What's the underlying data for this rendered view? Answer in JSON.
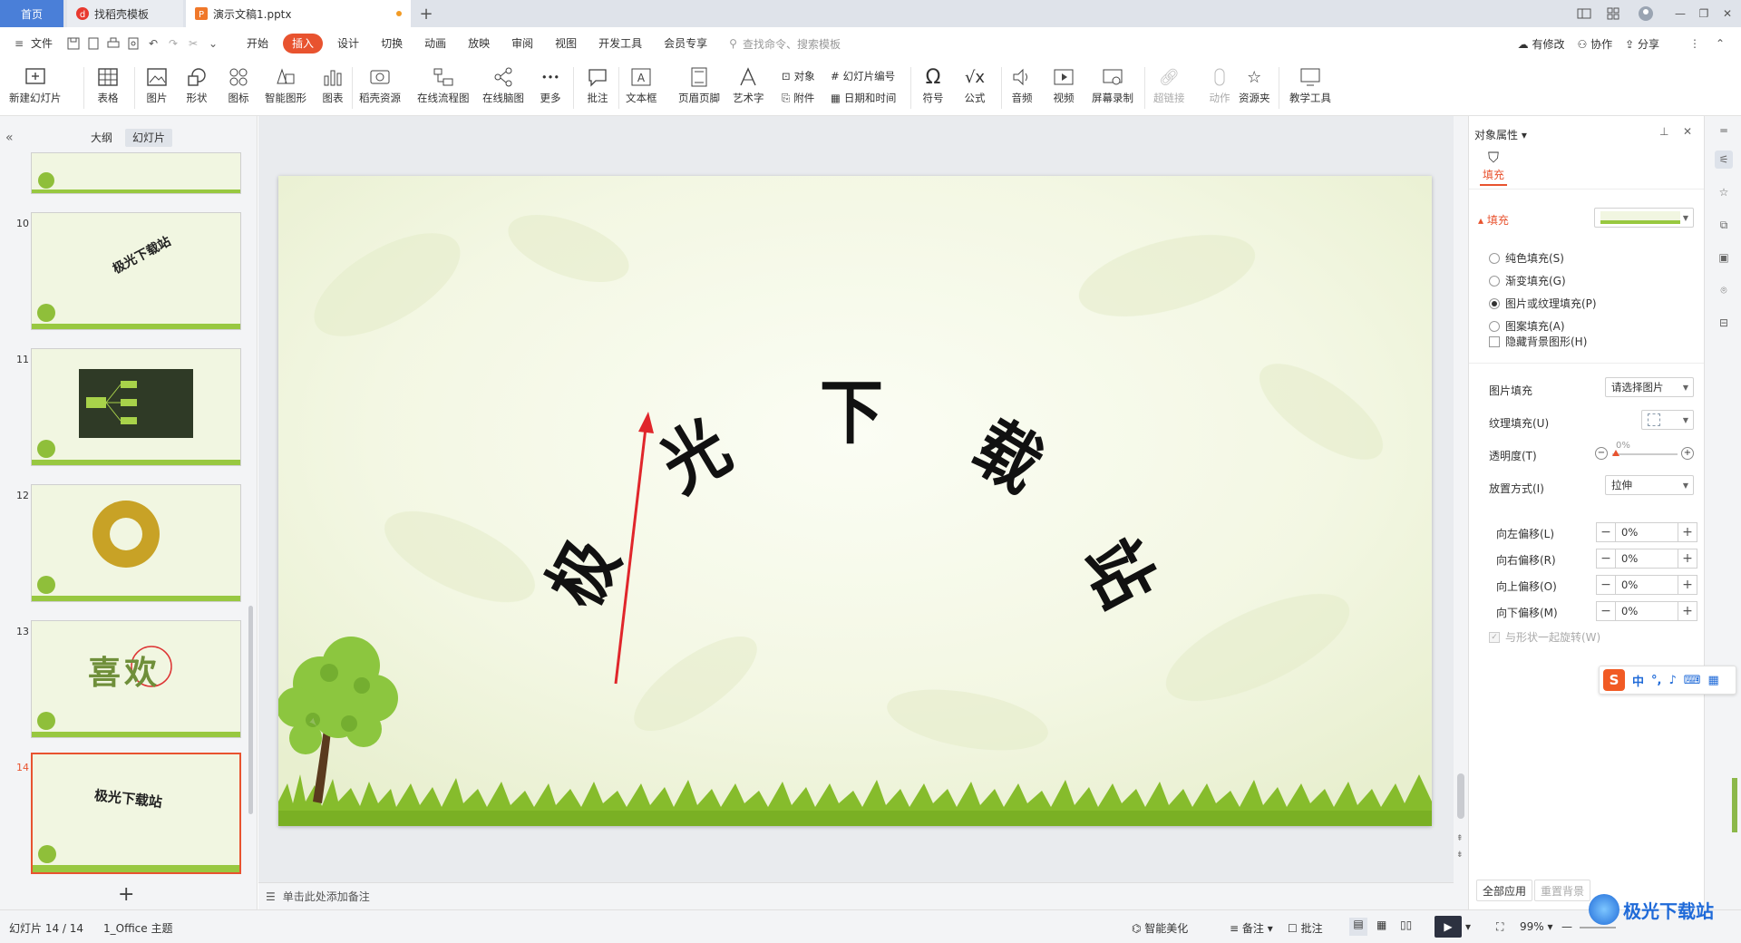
{
  "tabs": {
    "home": "首页",
    "template": "找稻壳模板",
    "document": "演示文稿1.pptx",
    "add": "+"
  },
  "menu": {
    "file": "文件",
    "items": [
      "开始",
      "插入",
      "设计",
      "切换",
      "动画",
      "放映",
      "审阅",
      "视图",
      "开发工具",
      "会员专享"
    ],
    "active": "插入",
    "search_placeholder": "查找命令、搜索模板",
    "right": {
      "modified": "有修改",
      "collab": "协作",
      "share": "分享"
    }
  },
  "ribbon": {
    "new_slide": "新建幻灯片",
    "table": "表格",
    "picture": "图片",
    "shape": "形状",
    "icon": "图标",
    "smartart": "智能图形",
    "chart": "图表",
    "daoke": "稻壳资源",
    "flowchart": "在线流程图",
    "mindmap": "在线脑图",
    "more": "更多",
    "comment": "批注",
    "textbox": "文本框",
    "header_footer": "页眉页脚",
    "wordart": "艺术字",
    "object": "对象",
    "attachment": "附件",
    "slide_number": "幻灯片编号",
    "datetime": "日期和时间",
    "symbol": "符号",
    "formula": "公式",
    "audio": "音频",
    "video": "视频",
    "screen_record": "屏幕录制",
    "hyperlink": "超链接",
    "action": "动作",
    "resource": "资源夹",
    "teaching": "教学工具"
  },
  "left_panel": {
    "tab_outline": "大纲",
    "tab_slides": "幻灯片",
    "slides": [
      {
        "num": "10",
        "text": "极光下载站"
      },
      {
        "num": "11",
        "text": ""
      },
      {
        "num": "12",
        "text": ""
      },
      {
        "num": "13",
        "text": "喜欢"
      },
      {
        "num": "14",
        "text": "极光下载站"
      }
    ],
    "add": "+"
  },
  "slide": {
    "title": "极光下载站"
  },
  "notes_placeholder": "单击此处添加备注",
  "right_panel": {
    "title": "对象属性",
    "tab_fill": "填充",
    "section": "填充",
    "options": [
      {
        "label": "纯色填充(S)",
        "checked": false
      },
      {
        "label": "渐变填充(G)",
        "checked": false
      },
      {
        "label": "图片或纹理填充(P)",
        "checked": true
      },
      {
        "label": "图案填充(A)",
        "checked": false
      }
    ],
    "hide_bg": "隐藏背景图形(H)",
    "picture_fill_label": "图片填充",
    "picture_fill_value": "请选择图片",
    "texture_fill_label": "纹理填充(U)",
    "transparency_label": "透明度(T)",
    "transparency_value": "0%",
    "placement_label": "放置方式(I)",
    "placement_value": "拉伸",
    "offsets": [
      {
        "label": "向左偏移(L)",
        "value": "0%"
      },
      {
        "label": "向右偏移(R)",
        "value": "0%"
      },
      {
        "label": "向上偏移(O)",
        "value": "0%"
      },
      {
        "label": "向下偏移(M)",
        "value": "0%"
      }
    ],
    "rotate_with_shape": "与形状一起旋转(W)",
    "apply_all": "全部应用",
    "reset_bg": "重置背景"
  },
  "status": {
    "slide_info": "幻灯片 14 / 14",
    "theme": "1_Office 主题",
    "beautify": "智能美化",
    "notes": "备注",
    "comment": "批注",
    "zoom": "99%"
  },
  "ime": {
    "lang": "中"
  },
  "watermark": "极光下载站",
  "colors": {
    "accent": "#e8532f",
    "home_tab": "#4a7fd8"
  }
}
